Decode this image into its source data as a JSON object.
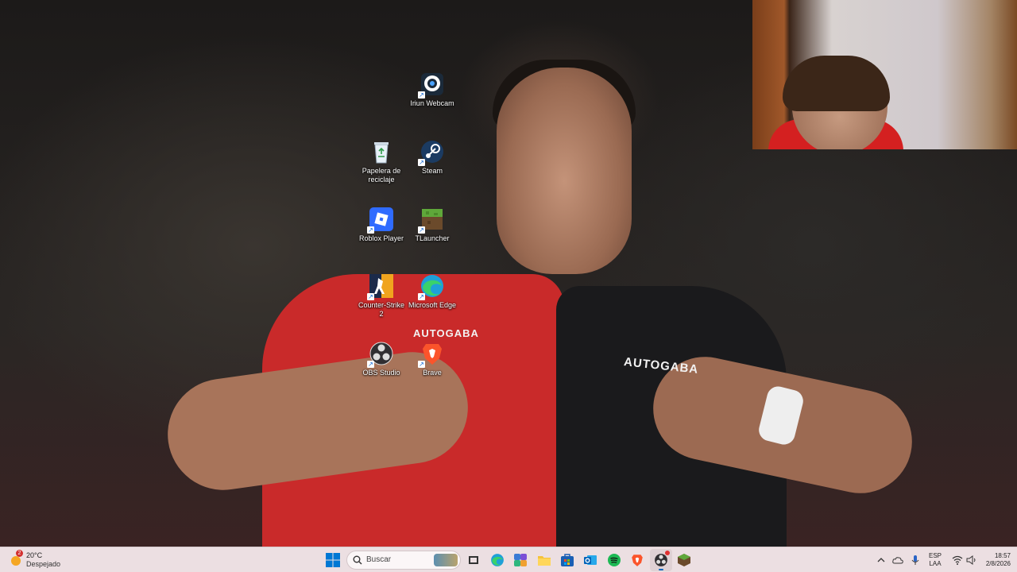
{
  "desktop": {
    "icons": [
      {
        "label": "Iriun Webcam",
        "icon": "webcam-icon"
      },
      {
        "label": "Papelera de reciclaje",
        "icon": "recycle-bin-icon"
      },
      {
        "label": "Steam",
        "icon": "steam-icon"
      },
      {
        "label": "Roblox Player",
        "icon": "roblox-icon"
      },
      {
        "label": "TLauncher",
        "icon": "tlauncher-icon"
      },
      {
        "label": "Counter-Strike 2",
        "icon": "counter-strike-icon"
      },
      {
        "label": "Microsoft Edge",
        "icon": "edge-icon"
      },
      {
        "label": "OBS Studio",
        "icon": "obs-icon"
      },
      {
        "label": "Brave",
        "icon": "brave-icon"
      }
    ],
    "wallpaper_text": {
      "sponsor_1": "AUTOGABA",
      "sponsor_2": "AUTOGABA"
    }
  },
  "taskbar": {
    "weather": {
      "temp": "20°C",
      "desc": "Despejado",
      "badge": "2"
    },
    "search_placeholder": "Buscar",
    "pinned": [
      {
        "name": "start-button",
        "icon": "windows-icon"
      },
      {
        "name": "search-box",
        "icon": "search-icon"
      },
      {
        "name": "task-view",
        "icon": "task-view-icon"
      },
      {
        "name": "edge",
        "icon": "edge-icon"
      },
      {
        "name": "copilot",
        "icon": "copilot-icon"
      },
      {
        "name": "file-explorer",
        "icon": "folder-icon"
      },
      {
        "name": "microsoft-store",
        "icon": "store-icon"
      },
      {
        "name": "outlook",
        "icon": "outlook-icon"
      },
      {
        "name": "spotify",
        "icon": "spotify-icon"
      },
      {
        "name": "brave",
        "icon": "brave-icon"
      },
      {
        "name": "obs",
        "icon": "obs-icon"
      },
      {
        "name": "tlauncher",
        "icon": "tlauncher-icon"
      }
    ],
    "tray": {
      "language": "ESP",
      "layout": "LAA",
      "time": "18:57",
      "date": "2/8/2026"
    }
  },
  "colors": {
    "taskbar_bg": "#ecdfe2",
    "accent": "#0067c0"
  }
}
